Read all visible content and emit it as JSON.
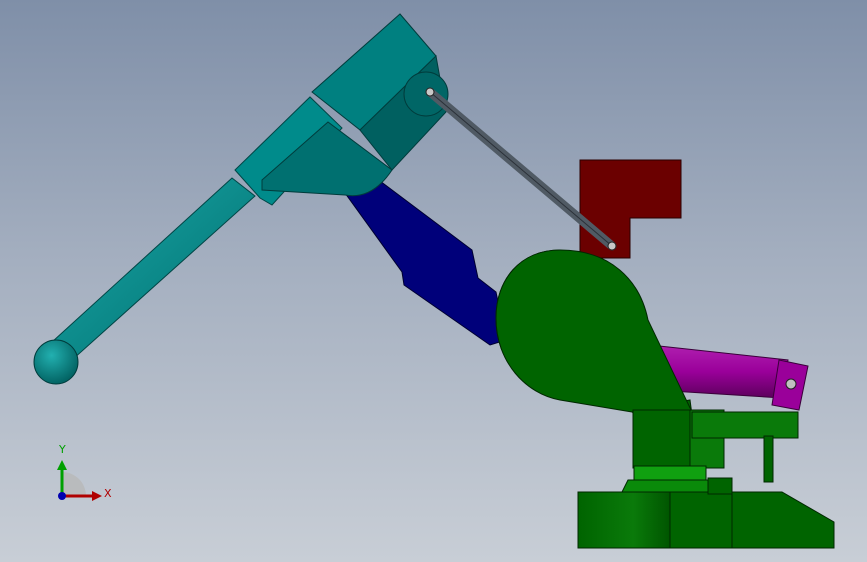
{
  "colors": {
    "arm_teal": "#008b8b",
    "arm_teal_dark": "#006464",
    "upper_link_navy": "#00007a",
    "base_green": "#006400",
    "base_green_light": "#0a8a0a",
    "counterweight_red": "#6b0000",
    "cylinder_magenta": "#8b008b",
    "linkage_gray": "#505a64",
    "axis_x": "#b00000",
    "axis_y": "#00a000",
    "axis_z": "#0000b0"
  },
  "triad": {
    "x_label": "X",
    "y_label": "Y"
  }
}
